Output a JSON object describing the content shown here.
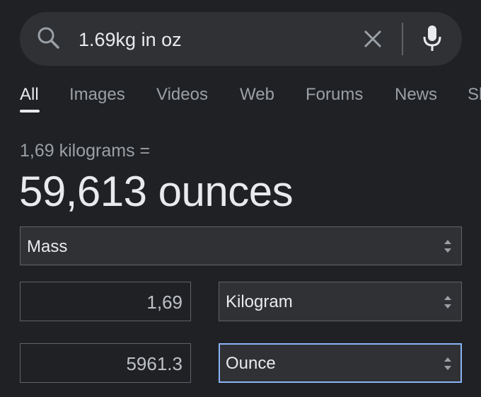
{
  "search": {
    "query": "1.69kg in oz"
  },
  "tabs": [
    {
      "label": "All",
      "active": true
    },
    {
      "label": "Images",
      "active": false
    },
    {
      "label": "Videos",
      "active": false
    },
    {
      "label": "Web",
      "active": false
    },
    {
      "label": "Forums",
      "active": false
    },
    {
      "label": "News",
      "active": false
    },
    {
      "label": "Sh",
      "active": false
    }
  ],
  "converter": {
    "from_text": "1,69 kilograms =",
    "result_text": "59,613 ounces",
    "category": "Mass",
    "from_value": "1,69",
    "from_unit": "Kilogram",
    "to_value": "5961.3",
    "to_unit": "Ounce"
  },
  "colors": {
    "background": "#202124",
    "surface": "#303134",
    "text": "#e8eaed",
    "muted": "#9aa0a6",
    "focus": "#8ab4f8"
  }
}
